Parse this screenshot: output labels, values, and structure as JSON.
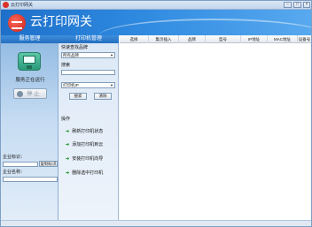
{
  "window": {
    "title": "云打印网关"
  },
  "banner": {
    "title": "云打印网关"
  },
  "left_panel": {
    "header": "服务管理",
    "status_text": "服务正在运行",
    "stop_button": "停 止",
    "company_id_label": "企业标识：",
    "copy_button": "复制标识",
    "company_name_label": "企业名称："
  },
  "middle_panel": {
    "header": "打印机管理",
    "filter_label": "快速查找品牌",
    "brand_select": "所有品牌",
    "search_label": "搜索",
    "search_value": "",
    "printer_select": "打印机IP",
    "search_button": "搜索",
    "clear_button": "清除",
    "ops_label": "操作",
    "operations": [
      "刷新打印机状态",
      "添加打印机到云",
      "安装打印机向导",
      "删除选中打印机"
    ]
  },
  "table": {
    "columns": [
      "选择",
      "集页插入",
      "品牌",
      "型号",
      "IP地址",
      "MAC地址",
      "设备号"
    ],
    "rows": []
  },
  "colors": {
    "banner": "#2f8ae0",
    "header": "#246fc0",
    "accent": "#2a9b3a"
  }
}
